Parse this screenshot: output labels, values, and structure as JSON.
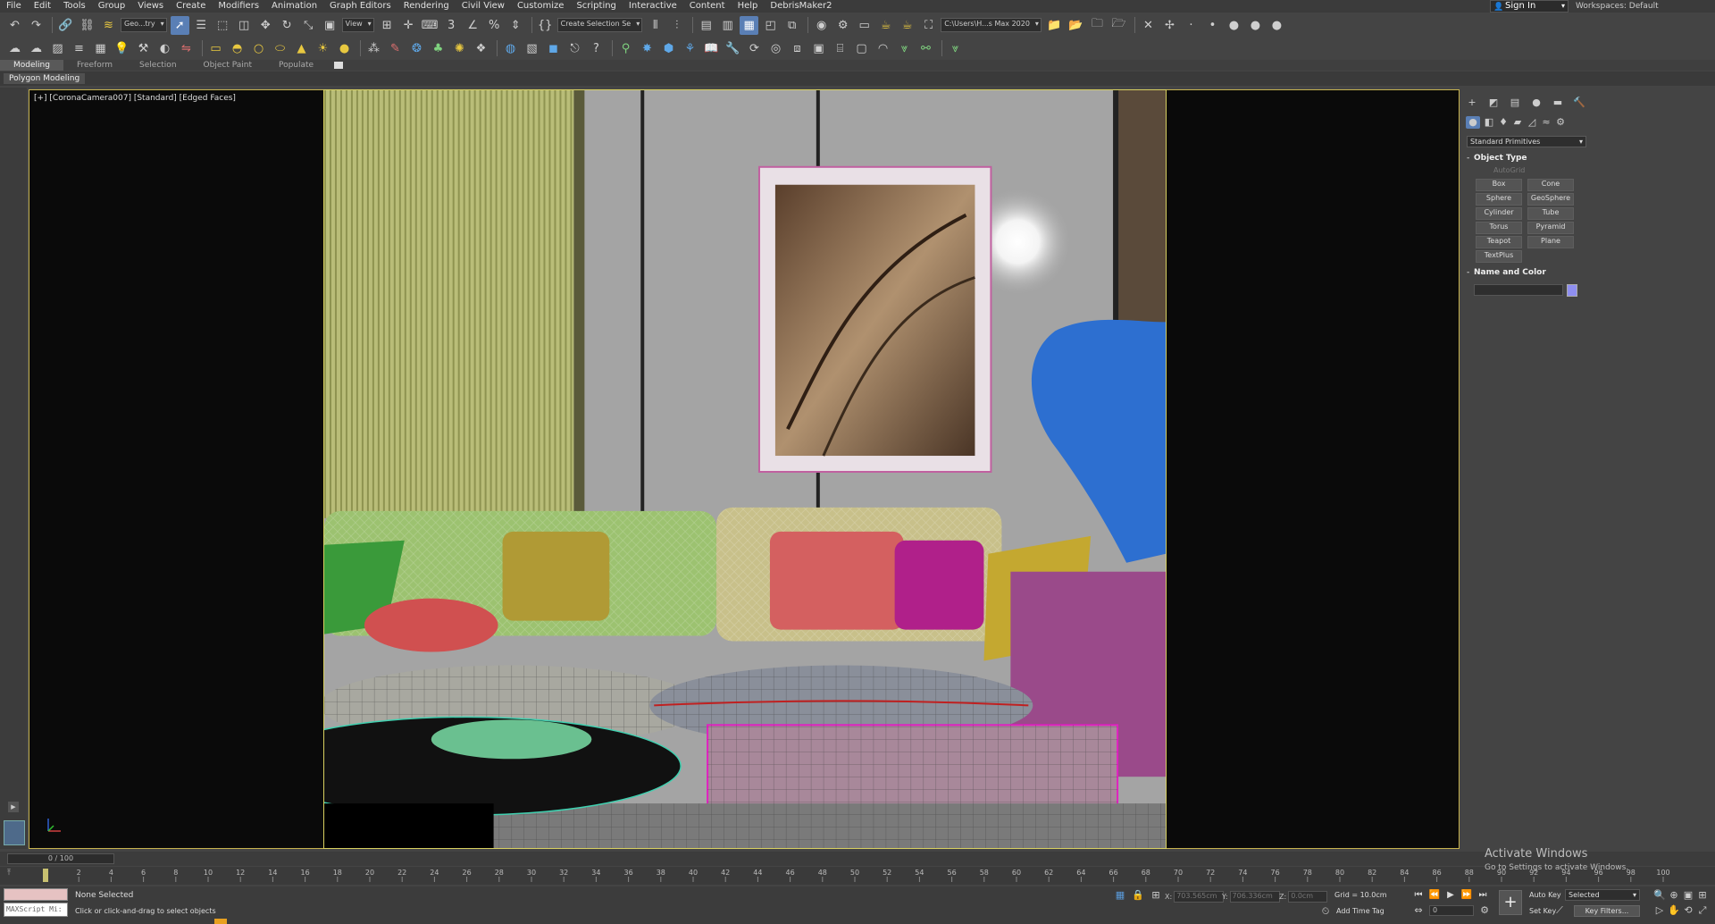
{
  "menu": [
    "File",
    "Edit",
    "Tools",
    "Group",
    "Views",
    "Create",
    "Modifiers",
    "Animation",
    "Graph Editors",
    "Rendering",
    "Civil View",
    "Customize",
    "Scripting",
    "Interactive",
    "Content",
    "Help",
    "DebrisMaker2"
  ],
  "signin": "Sign In",
  "workspaces": "Workspaces: Default",
  "toolbar": {
    "filter": "Geo...try",
    "refcoord": "View",
    "selset": "Create Selection Se",
    "path": "C:\\Users\\H...s Max 2020"
  },
  "ribbon": {
    "tabs": [
      "Modeling",
      "Freeform",
      "Selection",
      "Object Paint",
      "Populate"
    ],
    "active": "Modeling",
    "sub": "Polygon Modeling"
  },
  "viewport": {
    "label": "[+] [CoronaCamera007] [Standard] [Edged Faces]"
  },
  "command_panel": {
    "dropdown": "Standard Primitives",
    "object_type": "Object Type",
    "autogrid": "AutoGrid",
    "buttons": [
      "Box",
      "Cone",
      "Sphere",
      "GeoSphere",
      "Cylinder",
      "Tube",
      "Torus",
      "Pyramid",
      "Teapot",
      "Plane",
      "TextPlus"
    ],
    "name_and_color": "Name and Color",
    "color": "#8f8ff0"
  },
  "timeline": {
    "slider": "0 / 100",
    "ticks": [
      0,
      2,
      4,
      6,
      8,
      10,
      12,
      14,
      16,
      18,
      20,
      22,
      24,
      26,
      28,
      30,
      32,
      34,
      36,
      38,
      40,
      42,
      44,
      46,
      48,
      50,
      52,
      54,
      56,
      58,
      60,
      62,
      64,
      66,
      68,
      70,
      72,
      74,
      76,
      78,
      80,
      82,
      84,
      86,
      88,
      90,
      92,
      94,
      96,
      98,
      100
    ]
  },
  "status": {
    "maxscript": "MAXScript Mi:",
    "selection": "None Selected",
    "prompt": "Click or click-and-drag to select objects",
    "x_label": "X:",
    "x": "703.565cm",
    "y_label": "Y:",
    "y": "706.336cm",
    "z_label": "Z:",
    "z": "0.0cm",
    "grid": "Grid = 10.0cm",
    "add_time_tag": "Add Time Tag",
    "frame": "0",
    "auto_key": "Auto Key",
    "set_key": "Set Key",
    "key_mode": "Selected",
    "key_filters": "Key Filters..."
  },
  "watermark": {
    "line1": "Activate Windows",
    "line2": "Go to Settings to activate Windows."
  }
}
